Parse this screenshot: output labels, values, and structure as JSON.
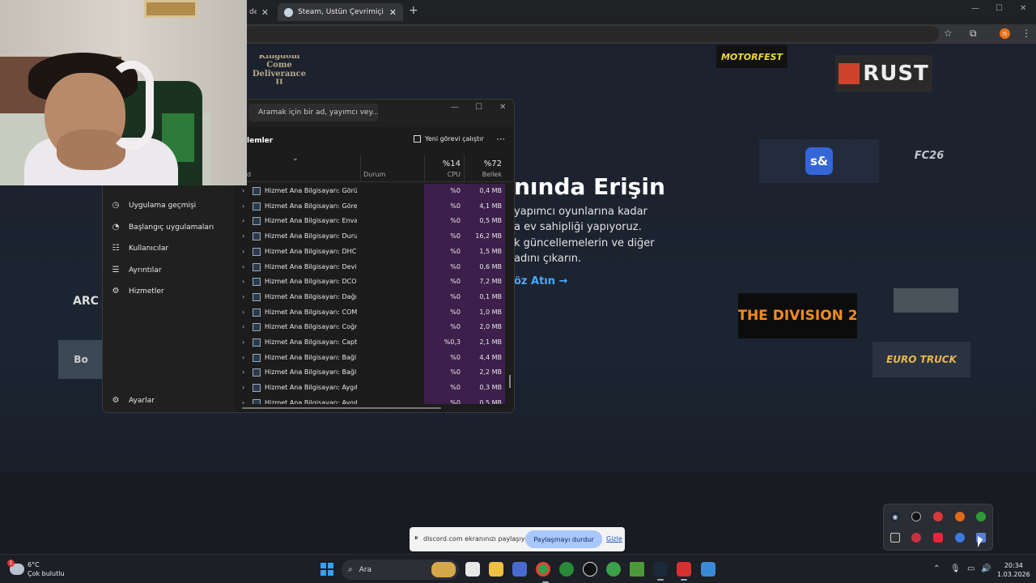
{
  "browser": {
    "tabs": [
      {
        "label": "de",
        "active": false
      },
      {
        "label": "Steam, Üstün Çevrimiçi Oyun P",
        "active": true
      }
    ],
    "new_tab_icon": "plus-icon",
    "profile_initial": "n"
  },
  "steam_page": {
    "hero_title": "nında Erişin",
    "hero_lines": [
      "yapımcı oyunlarına kadar",
      "a ev sahipliği yapıyoruz.",
      "k güncellemelerin ve diğer",
      "adını çıkarın."
    ],
    "hero_link": "öz Atın →",
    "logos": {
      "kcd": "Kingdom Come Deliverance II",
      "motorfest": "MOTORFEST",
      "rust": "RUST",
      "sandbox": "s&",
      "fc": "FC26",
      "division": "THE DIVISION 2",
      "small": "",
      "euro": "EURO TRUCK",
      "arc": "ARC",
      "bo": "Bo"
    }
  },
  "task_manager": {
    "search_placeholder": "Aramak için bir ad, yayımcı vey...",
    "page_title": "lemler",
    "run_new_task": "Yeni görevi çalıştır",
    "more_icon": "more-icon",
    "sidebar": [
      {
        "label": "Uygulama geçmişi",
        "icon": "history-icon"
      },
      {
        "label": "Başlangıç uygulamaları",
        "icon": "startup-icon"
      },
      {
        "label": "Kullanıcılar",
        "icon": "users-icon"
      },
      {
        "label": "Ayrıntılar",
        "icon": "details-icon"
      },
      {
        "label": "Hizmetler",
        "icon": "services-icon"
      }
    ],
    "settings_label": "Ayarlar",
    "columns": {
      "name": "d",
      "status": "Durum",
      "cpu_pct": "%14",
      "cpu": "CPU",
      "mem_pct": "%72",
      "mem": "Bellek"
    },
    "rows": [
      {
        "name": "Hizmet Ana Bilgisayarı: Görün...",
        "cpu": "%0",
        "mem": "0,4 MB"
      },
      {
        "name": "Hizmet Ana Bilgisayarı: Görev ...",
        "cpu": "%0",
        "mem": "4,1 MB"
      },
      {
        "name": "Hizmet Ana Bilgisayarı: Envant...",
        "cpu": "%0",
        "mem": "0,5 MB"
      },
      {
        "name": "Hizmet Ana Bilgisayarı: Duru...",
        "cpu": "%0",
        "mem": "16,2 MB"
      },
      {
        "name": "Hizmet Ana Bilgisayarı: DHCP ...",
        "cpu": "%0",
        "mem": "1,5 MB"
      },
      {
        "name": "Hizmet Ana Bilgisayarı: Device...",
        "cpu": "%0",
        "mem": "0,6 MB"
      },
      {
        "name": "Hizmet Ana Bilgisayarı: DCOM...",
        "cpu": "%0",
        "mem": "7,2 MB"
      },
      {
        "name": "Hizmet Ana Bilgisayarı: Dağıtıl...",
        "cpu": "%0",
        "mem": "0,1 MB"
      },
      {
        "name": "Hizmet Ana Bilgisayarı: COM+...",
        "cpu": "%0",
        "mem": "1,0 MB"
      },
      {
        "name": "Hizmet Ana Bilgisayarı: Coğraf...",
        "cpu": "%0",
        "mem": "2,0 MB"
      },
      {
        "name": "Hizmet Ana Bilgisayarı: Captur...",
        "cpu": "%0,3",
        "mem": "2,1 MB"
      },
      {
        "name": "Hizmet Ana Bilgisayarı: Bağlı ...",
        "cpu": "%0",
        "mem": "4,4 MB"
      },
      {
        "name": "Hizmet Ana Bilgisayarı: Bağlı ...",
        "cpu": "%0",
        "mem": "2,2 MB"
      },
      {
        "name": "Hizmet Ana Bilgisayarı: Aygıt ...",
        "cpu": "%0",
        "mem": "0,3 MB"
      },
      {
        "name": "Hizmet Ana Bilgisayarı: Aygıt İ...",
        "cpu": "%0",
        "mem": "0,5 MB"
      }
    ]
  },
  "discord_share": {
    "message": "discord.com ekranınızı paylaşıyor.",
    "stop_label": "Paylaşmayı durdur",
    "hide_label": "Gizle"
  },
  "taskbar": {
    "weather_temp": "6°C",
    "weather_desc": "Çok bulutlu",
    "weather_badge": "1",
    "search_label": "Ara",
    "time": "20:34",
    "date": "1.03.2026"
  },
  "colors": {
    "steam_link": "#4aa8ff",
    "cpu_highlight": "#3c1f4a",
    "share_button": "#a8c7fa"
  }
}
